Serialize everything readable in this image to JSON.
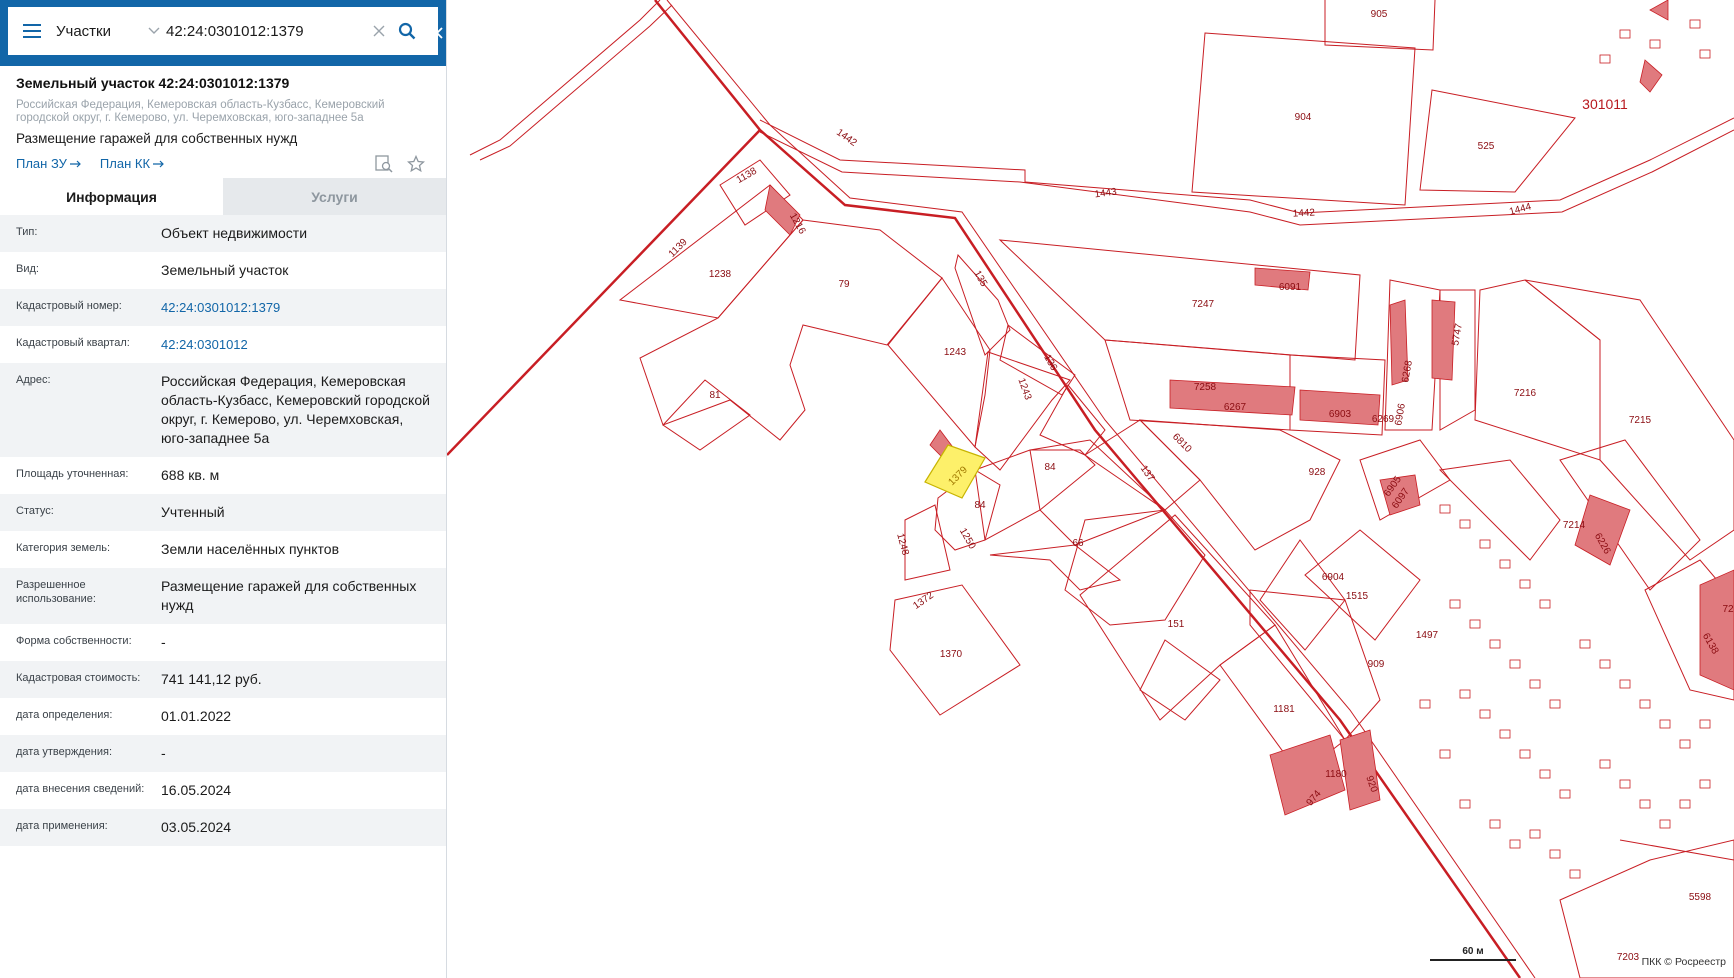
{
  "search": {
    "layer": "Участки",
    "query": "42:24:0301012:1379"
  },
  "object": {
    "title": "Земельный участок 42:24:0301012:1379",
    "address_line": "Российская Федерация, Кемеровская область-Кузбасс, Кемеровский городской округ, г. Кемерово, ул. Черемховская, юго-западнее 5а",
    "purpose": "Размещение гаражей для собственных нужд",
    "link_plan_zu": "План ЗУ",
    "link_plan_kk": "План КК"
  },
  "tabs": {
    "info": "Информация",
    "services": "Услуги"
  },
  "attributes": [
    {
      "label": "Тип:",
      "value": "Объект недвижимости"
    },
    {
      "label": "Вид:",
      "value": "Земельный участок"
    },
    {
      "label": "Кадастровый номер:",
      "value": "42:24:0301012:1379"
    },
    {
      "label": "Кадастровый квартал:",
      "value": "42:24:0301012"
    },
    {
      "label": "Адрес:",
      "value": "Российская Федерация, Кемеровская область-Кузбасс, Кемеровский городской округ, г. Кемерово, ул. Черемховская, юго-западнее 5а"
    },
    {
      "label": "Площадь уточненная:",
      "value": "688 кв. м"
    },
    {
      "label": "Статус:",
      "value": "Учтенный"
    },
    {
      "label": "Категория земель:",
      "value": "Земли населённых пунктов"
    },
    {
      "label": "Разрешенное использование:",
      "value": "Размещение гаражей для собственных нужд"
    },
    {
      "label": "Форма собственности:",
      "value": "-"
    },
    {
      "label": "Кадастровая стоимость:",
      "value": "741 141,12 руб."
    },
    {
      "label": "дата определения:",
      "value": "01.01.2022"
    },
    {
      "label": "дата утверждения:",
      "value": "-"
    },
    {
      "label": "дата внесения сведений:",
      "value": "16.05.2024"
    },
    {
      "label": "дата применения:",
      "value": "03.05.2024"
    }
  ],
  "map": {
    "quarter_label": "301011",
    "scale_label": "60 м",
    "attribution": "ПКК © Росреестр",
    "parcel_labels": [
      "905",
      "904",
      "525",
      "1442",
      "1443",
      "1444",
      "1138",
      "1216",
      "1139",
      "1238",
      "79",
      "135",
      "7247",
      "6091",
      "5747",
      "1243",
      "136",
      "1243",
      "7258",
      "6267",
      "6903",
      "6269",
      "6268",
      "6906",
      "7216",
      "7215",
      "81",
      "6810",
      "928",
      "1379",
      "84",
      "84",
      "137",
      "6905",
      "6097",
      "7214",
      "6226",
      "1248",
      "1250",
      "66",
      "6904",
      "1515",
      "1497",
      "1372",
      "151",
      "909",
      "1370",
      "1181",
      "1180",
      "920",
      "974",
      "5598",
      "7203",
      "6138",
      "72"
    ],
    "colors": {
      "boundary": "#c81e24",
      "building_fill": "#e07a7e",
      "selected_fill": "#fdf06a",
      "label": "#8b0d12"
    }
  }
}
